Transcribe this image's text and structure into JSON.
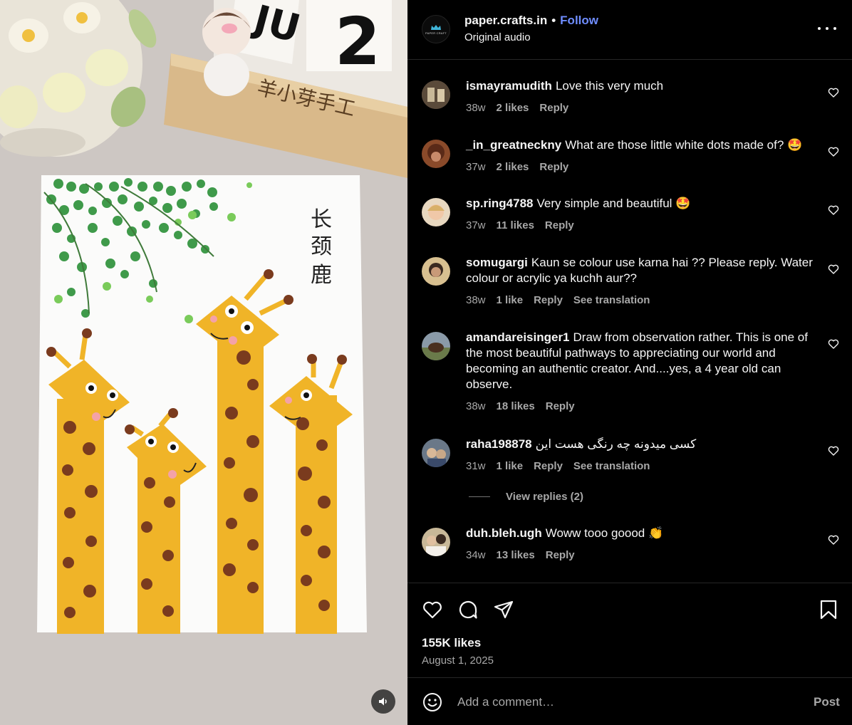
{
  "post": {
    "author": "paper.crafts.in",
    "follow_label": "Follow",
    "audio": "Original audio",
    "avatar_text": "PAPER CRAFT",
    "likes": "155K likes",
    "date": "August 1, 2025",
    "comment_placeholder": "Add a comment…",
    "post_label": "Post"
  },
  "media": {
    "artwork_text": "长颈鹿",
    "calendar_month": "JUL",
    "calendar_day": "2",
    "nameplate": "羊小芽手工"
  },
  "comments": [
    {
      "user": "ismayramudith",
      "text": "Love this very much",
      "age": "38w",
      "likes": "2 likes",
      "reply": "Reply",
      "avatar_color": "#6b5a4a"
    },
    {
      "user": "_in_greatneckny",
      "text": "What are those little white dots made of? 🤩",
      "age": "37w",
      "likes": "2 likes",
      "reply": "Reply",
      "avatar_color": "#8a4a2a"
    },
    {
      "user": "sp.ring4788",
      "text": "Very simple and beautiful 🤩",
      "age": "37w",
      "likes": "11 likes",
      "reply": "Reply",
      "avatar_color": "#e0c8a8"
    },
    {
      "user": "somugargi",
      "text": "Kaun se colour use karna hai ?? Please reply. Water colour or acrylic ya kuchh aur??",
      "age": "38w",
      "likes": "1 like",
      "reply": "Reply",
      "translate": "See translation",
      "avatar_color": "#c89a5a"
    },
    {
      "user": "amandareisinger1",
      "text": "Draw from observation rather. This is one of the most beautiful pathways to appreciating our world and becoming an authentic creator. And....yes, a 4 year old can observe.",
      "age": "38w",
      "likes": "18 likes",
      "reply": "Reply",
      "avatar_color": "#7a6a4a"
    },
    {
      "user": "raha198878",
      "text": "کسی میدونه چه رنگی هست این",
      "age": "31w",
      "likes": "1 like",
      "reply": "Reply",
      "translate": "See translation",
      "avatar_color": "#5a6a8a"
    },
    {
      "user": "duh.bleh.ugh",
      "text": "Woww tooo goood 👏",
      "age": "34w",
      "likes": "13 likes",
      "reply": "Reply",
      "avatar_color": "#b8a080"
    }
  ],
  "view_replies": "View replies (2)",
  "icons": {
    "like": "heart-icon",
    "comment": "comment-icon",
    "share": "share-icon",
    "save": "bookmark-icon",
    "emoji": "emoji-icon",
    "more": "more-icon",
    "mute": "speaker-icon"
  },
  "colors": {
    "accent": "#6f8dff",
    "secondary_text": "#a8a8a8",
    "background": "#000000",
    "divider": "#262626"
  }
}
